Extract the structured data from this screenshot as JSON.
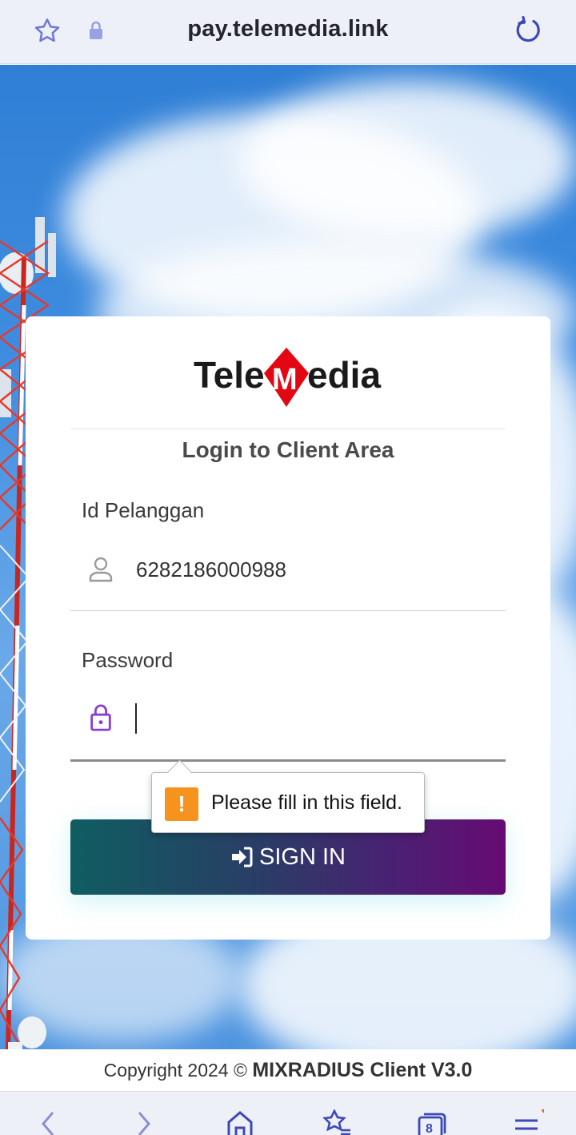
{
  "browser": {
    "url": "pay.telemedia.link",
    "icons": [
      "star-icon",
      "lock-icon",
      "reload-icon"
    ]
  },
  "card": {
    "logo_text_left": "Tele",
    "logo_text_m": "M",
    "logo_text_right": "edia",
    "title": "Login to Client Area"
  },
  "fields": {
    "id_label": "Id Pelanggan",
    "id_value": "6282186000988",
    "password_label": "Password",
    "password_value": ""
  },
  "tooltip": {
    "message": "Please fill in this field."
  },
  "button": {
    "signin_label": "SIGN IN"
  },
  "footer": {
    "prefix": "Copyright 2024 © ",
    "brand": "MIXRADIUS Client V3.0"
  },
  "bottom_nav": {
    "tabs_count": "8",
    "icons": [
      "back-icon",
      "forward-icon",
      "home-icon",
      "bookmarks-icon",
      "tabs-icon",
      "menu-icon"
    ]
  },
  "colors": {
    "accent": "#8a3fd0",
    "button_start": "#0f5d61",
    "button_end": "#660b73",
    "logo_red": "#e30613",
    "browser_icon": "#4a55c8",
    "notification_dot": "#f0641e"
  }
}
